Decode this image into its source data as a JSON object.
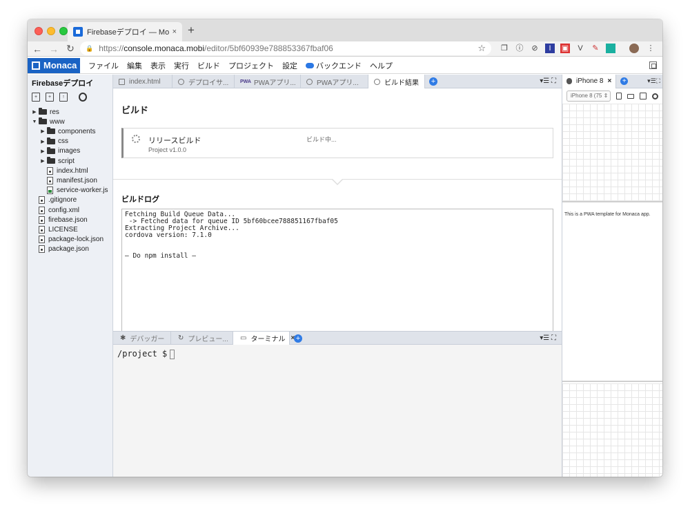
{
  "browser": {
    "tab_title": "Firebaseデプロイ — Monaca Cl",
    "tab_close": "×",
    "new_tab": "+",
    "url_host": "console.monaca.mobi",
    "url_prefix": "https://",
    "url_path": "/editor/5bf60939e788853367fbaf06"
  },
  "menubar": {
    "logo": "Monaca",
    "items": [
      "ファイル",
      "編集",
      "表示",
      "実行",
      "ビルド",
      "プロジェクト",
      "設定",
      "バックエンド",
      "ヘルプ"
    ]
  },
  "sidebar": {
    "project_title": "Firebaseデプロイ",
    "tree": [
      {
        "label": "res",
        "kind": "folder",
        "level": 0,
        "arrow": "▶"
      },
      {
        "label": "www",
        "kind": "folder",
        "level": 0,
        "arrow": "▼"
      },
      {
        "label": "components",
        "kind": "folder",
        "level": 1,
        "arrow": "▶"
      },
      {
        "label": "css",
        "kind": "folder",
        "level": 1,
        "arrow": "▶"
      },
      {
        "label": "images",
        "kind": "folder",
        "level": 1,
        "arrow": "▶"
      },
      {
        "label": "script",
        "kind": "folder",
        "level": 1,
        "arrow": "▶"
      },
      {
        "label": "index.html",
        "kind": "file",
        "level": 1,
        "arrow": ""
      },
      {
        "label": "manifest.json",
        "kind": "file",
        "level": 1,
        "arrow": ""
      },
      {
        "label": "service-worker.js",
        "kind": "file",
        "level": 1,
        "arrow": ""
      },
      {
        "label": ".gitignore",
        "kind": "file",
        "level": 0,
        "arrow": ""
      },
      {
        "label": "config.xml",
        "kind": "file",
        "level": 0,
        "arrow": ""
      },
      {
        "label": "firebase.json",
        "kind": "file",
        "level": 0,
        "arrow": ""
      },
      {
        "label": "LICENSE",
        "kind": "file",
        "level": 0,
        "arrow": ""
      },
      {
        "label": "package-lock.json",
        "kind": "file",
        "level": 0,
        "arrow": ""
      },
      {
        "label": "package.json",
        "kind": "file",
        "level": 0,
        "arrow": ""
      }
    ]
  },
  "editor_tabs": [
    {
      "label": "index.html",
      "active": false
    },
    {
      "label": "デプロイサ...",
      "active": false
    },
    {
      "label": "PWAアプリ...",
      "active": false
    },
    {
      "label": "PWAアプリ...",
      "active": false
    },
    {
      "label": "ビルド結果",
      "active": true
    }
  ],
  "build": {
    "heading": "ビルド",
    "release_label": "リリースビルド",
    "status": "ビルド中...",
    "version": "Project v1.0.0",
    "log_heading": "ビルドログ",
    "log_lines": [
      "Fetching Build Queue Data...",
      " -> Fetched data for queue ID 5bf60bcee788851167fbaf05",
      "Extracting Project Archive...",
      "cordova version: 7.1.0",
      "",
      "",
      "– Do npm install –"
    ]
  },
  "bottom_tabs": [
    {
      "label": "デバッガー",
      "glyph": "✱",
      "active": false
    },
    {
      "label": "プレビュー...",
      "glyph": "↻",
      "active": false
    },
    {
      "label": "ターミナル",
      "glyph": "▭",
      "active": true
    }
  ],
  "terminal": {
    "prompt": "/project $"
  },
  "preview": {
    "device_tab": "iPhone 8",
    "device_select": "iPhone 8 (75",
    "screen_text": "This is a PWA template for Monaca app."
  }
}
